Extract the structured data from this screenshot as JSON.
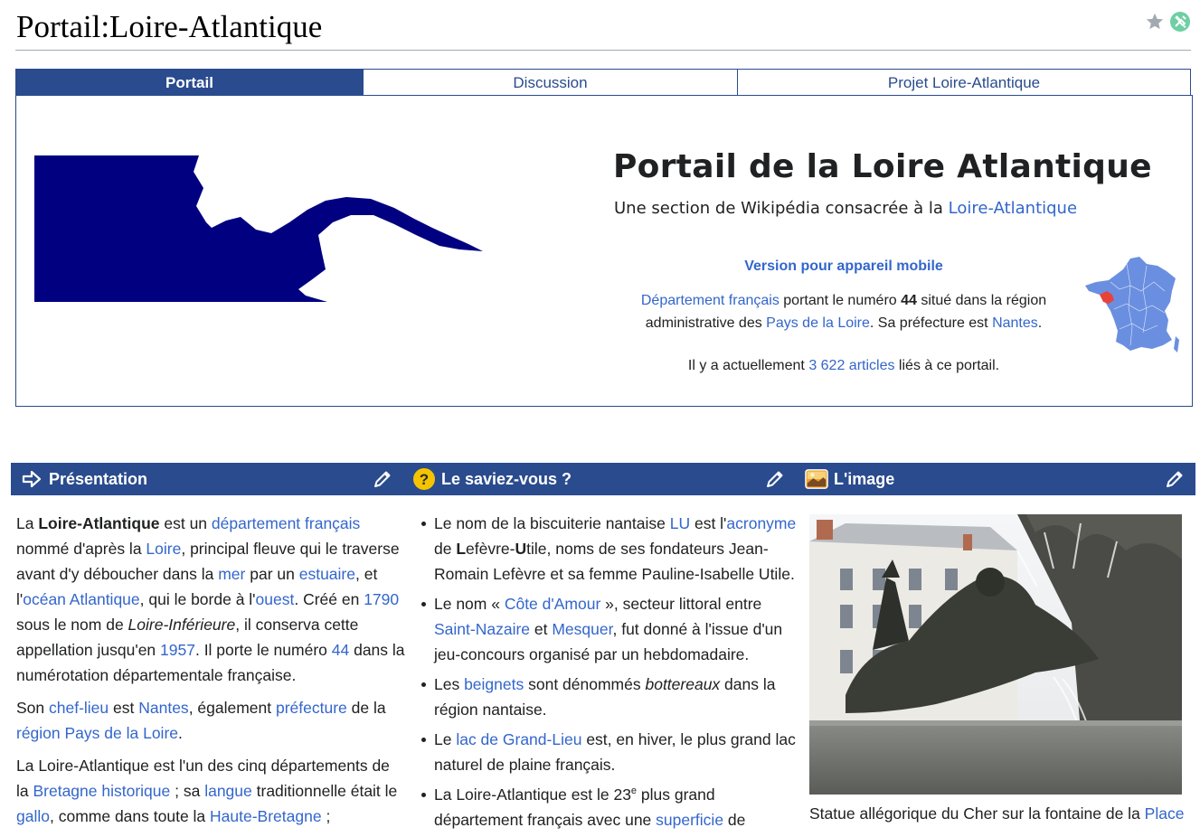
{
  "title": "Portail:Loire-Atlantique",
  "title_icons": [
    "star-icon",
    "tools-icon"
  ],
  "tabs": [
    {
      "label": "Portail",
      "active": true
    },
    {
      "label": "Discussion",
      "active": false
    },
    {
      "label": "Projet Loire-Atlantique",
      "active": false
    }
  ],
  "banner": {
    "title": "Portail de la Loire Atlantique",
    "subtitle_prefix": "Une section de Wikipédia consacrée à la ",
    "subtitle_link": "Loire-Atlantique",
    "mobile_link": "Version pour appareil mobile",
    "desc": {
      "link1": "Département français",
      "t1": " portant le numéro ",
      "num": "44",
      "t2": " situé dans la région administrative des ",
      "link2": "Pays de la Loire",
      "t3": ". Sa préfecture est ",
      "link3": "Nantes",
      "t4": "."
    },
    "count_prefix": "Il y a actuellement ",
    "count_link": "3 622 articles",
    "count_suffix": " liés à ce portail."
  },
  "sections": {
    "presentation": {
      "title": "Présentation",
      "icon": "arrow-right-icon"
    },
    "saviez": {
      "title": "Le saviez-vous ?",
      "icon": "question-icon"
    },
    "image": {
      "title": "L'image",
      "icon": "picture-icon"
    }
  },
  "presentation": {
    "p1": [
      "La ",
      "Loire-Atlantique",
      " est un ",
      "département français",
      " nommé d'après la ",
      "Loire",
      ", principal fleuve qui le traverse avant d'y déboucher dans la ",
      "mer",
      " par un ",
      "estuaire",
      ", et l'",
      "océan Atlantique",
      ", qui le borde à l'",
      "ouest",
      ". Créé en ",
      "1790",
      " sous le nom de ",
      "Loire-Inférieure",
      ", il conserva cette appellation jusqu'en ",
      "1957",
      ". Il porte le numéro ",
      "44",
      " dans la numérotation départementale française."
    ],
    "p2": [
      "Son ",
      "chef-lieu",
      " est ",
      "Nantes",
      ", également ",
      "préfecture",
      " de la ",
      "région Pays de la Loire",
      "."
    ],
    "p3": [
      "La Loire-Atlantique est l'un des cinq départements de la ",
      "Bretagne historique",
      " ; sa ",
      "langue",
      " traditionnelle était le ",
      "gallo",
      ", comme dans toute la ",
      "Haute-Bretagne",
      " ;"
    ]
  },
  "saviez": {
    "b1": [
      "Le nom de la biscuiterie nantaise ",
      "LU",
      " est l'",
      "acronyme",
      " de ",
      "L",
      "efèvre-",
      "U",
      "tile, noms de ses fondateurs Jean-Romain Lefèvre et sa femme Pauline-Isabelle Utile."
    ],
    "b2": [
      "Le nom « ",
      "Côte d'Amour",
      " », secteur littoral entre ",
      "Saint-Nazaire",
      " et ",
      "Mesquer",
      ", fut donné à l'issue d'un jeu-concours organisé par un hebdomadaire."
    ],
    "b3": [
      "Les ",
      "beignets",
      " sont dénommés ",
      "bottereaux",
      " dans la région nantaise."
    ],
    "b4": [
      "Le ",
      "lac de Grand-Lieu",
      " est, en hiver, le plus grand lac naturel de plaine français."
    ],
    "b5": [
      "La Loire-Atlantique est le 23",
      "e",
      " plus grand département français avec une ",
      "superficie",
      " de"
    ]
  },
  "image": {
    "caption_text": "Statue allégorique du Cher sur la fontaine de la ",
    "caption_link": "Place"
  },
  "colors": {
    "accent": "#2a4b8d",
    "link": "#3366cc",
    "flag": "#000080",
    "map_blue": "#6b8fe0",
    "map_red": "#e8423a"
  }
}
